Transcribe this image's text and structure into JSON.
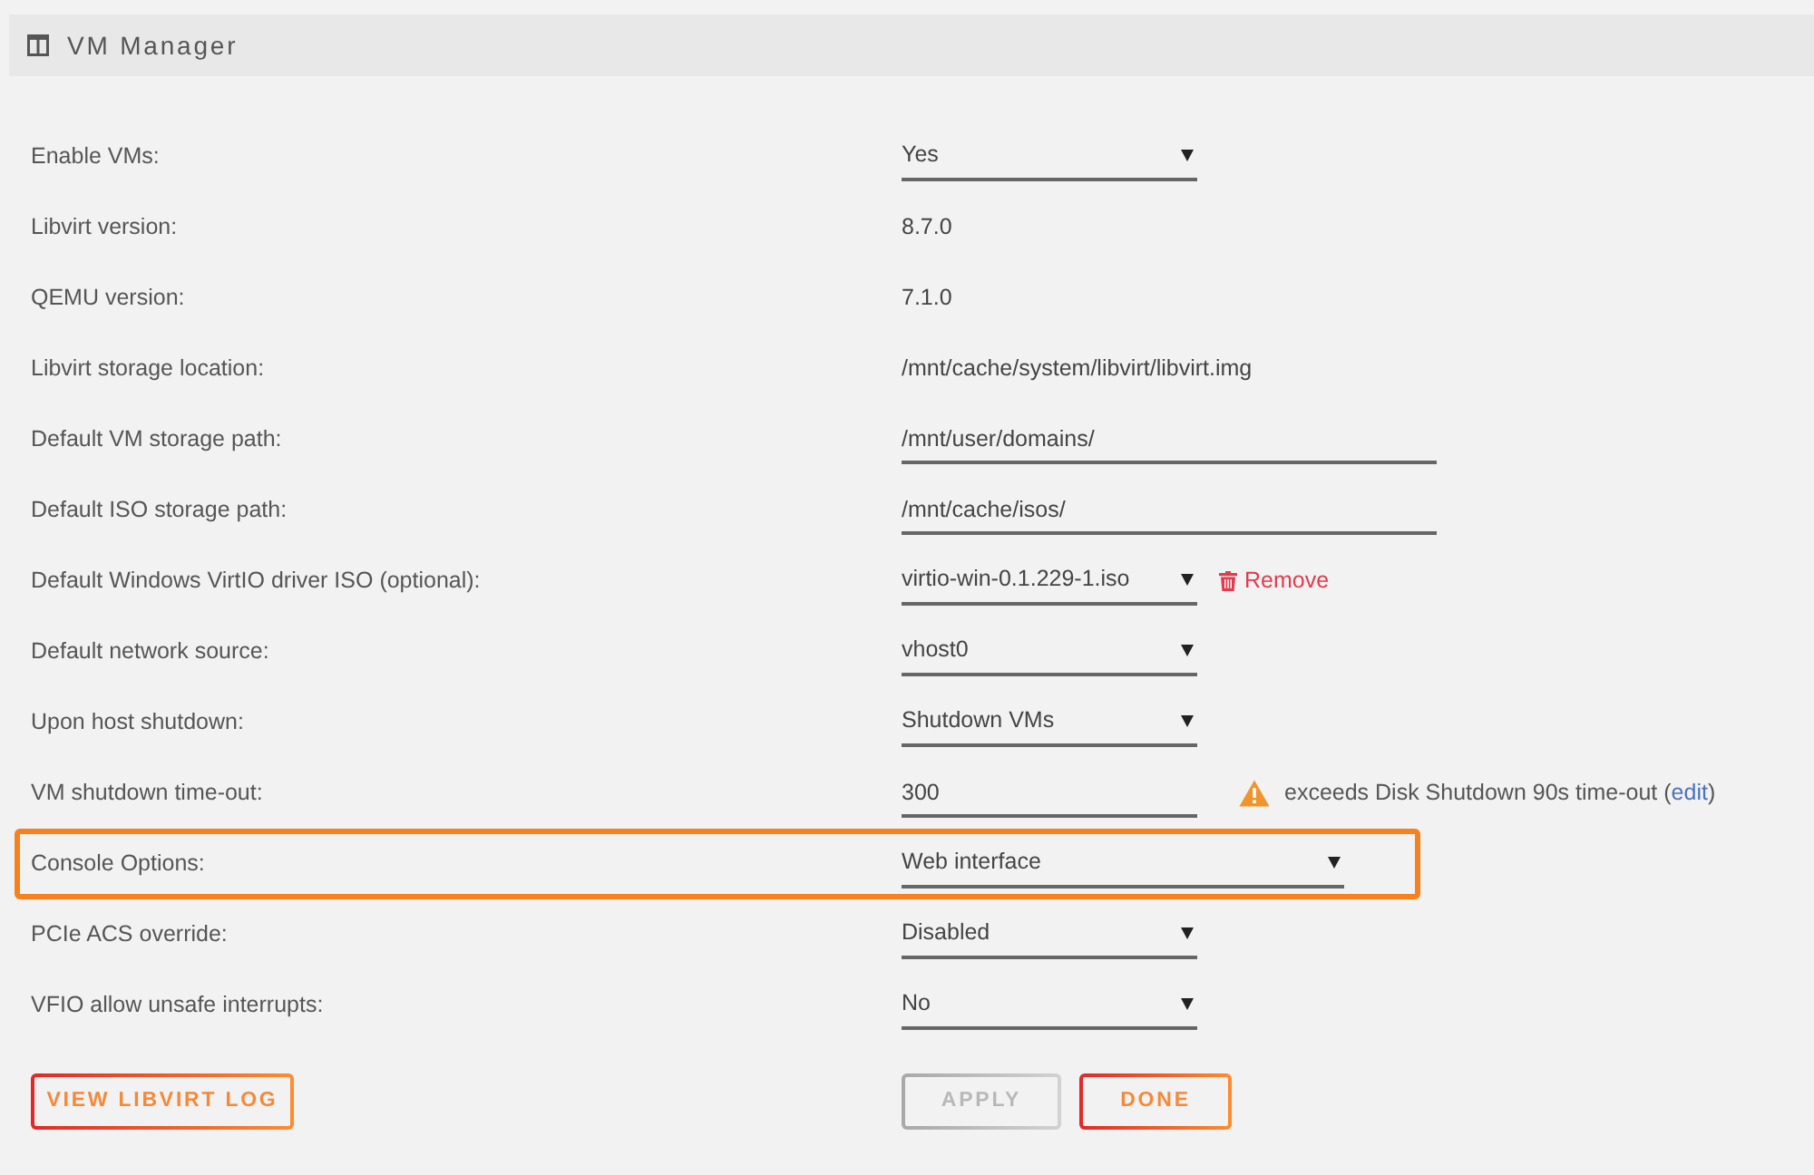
{
  "header": {
    "title": "VM Manager"
  },
  "settings": [
    {
      "label": "Enable VMs:",
      "kind": "select",
      "value": "Yes",
      "highlighted": false
    },
    {
      "label": "Libvirt version:",
      "kind": "static",
      "value": "8.7.0",
      "highlighted": false
    },
    {
      "label": "QEMU version:",
      "kind": "static",
      "value": "7.1.0",
      "highlighted": false
    },
    {
      "label": "Libvirt storage location:",
      "kind": "static",
      "value": "/mnt/cache/system/libvirt/libvirt.img",
      "highlighted": false
    },
    {
      "label": "Default VM storage path:",
      "kind": "input",
      "value": "/mnt/user/domains/",
      "highlighted": false
    },
    {
      "label": "Default ISO storage path:",
      "kind": "input",
      "value": "/mnt/cache/isos/",
      "highlighted": false
    },
    {
      "label": "Default Windows VirtIO driver ISO (optional):",
      "kind": "select",
      "value": "virtio-win-0.1.229-1.iso",
      "highlighted": false,
      "action": {
        "label": "Remove"
      }
    },
    {
      "label": "Default network source:",
      "kind": "select",
      "value": "vhost0",
      "highlighted": false
    },
    {
      "label": "Upon host shutdown:",
      "kind": "select",
      "value": "Shutdown VMs",
      "highlighted": false
    },
    {
      "label": "VM shutdown time-out:",
      "kind": "number",
      "value": "300",
      "highlighted": false,
      "warning": {
        "text": "exceeds Disk Shutdown 90s time-out (",
        "link": "edit",
        "text_after": ")"
      }
    },
    {
      "label": "Console Options:",
      "kind": "select",
      "value": "Web interface",
      "highlighted": true
    },
    {
      "label": "PCIe ACS override:",
      "kind": "select",
      "value": "Disabled",
      "highlighted": false
    },
    {
      "label": "VFIO allow unsafe interrupts:",
      "kind": "select",
      "value": "No",
      "highlighted": false
    }
  ],
  "footer": {
    "left_buttons": [
      {
        "label": "VIEW LIBVIRT LOG",
        "disabled": false
      }
    ],
    "right_buttons": [
      {
        "label": "APPLY",
        "disabled": true
      },
      {
        "label": "DONE",
        "disabled": false
      }
    ]
  }
}
